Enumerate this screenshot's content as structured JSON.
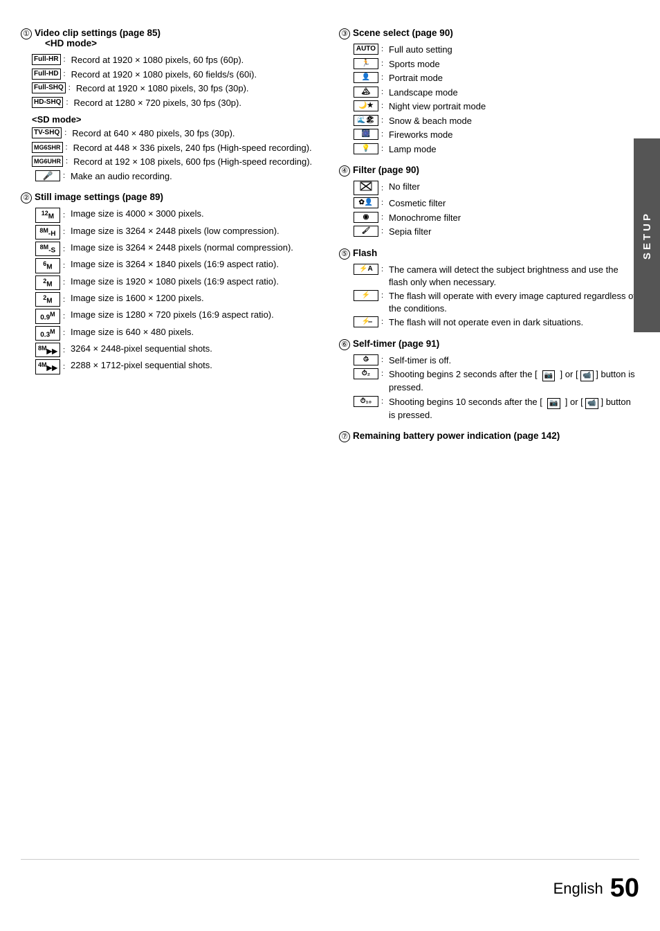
{
  "page": {
    "setup_label": "SETUP",
    "footer": {
      "language": "English",
      "page_number": "50"
    }
  },
  "left_column": {
    "section1": {
      "num": "①",
      "title": "Video clip settings (page 85) <HD mode>",
      "items": [
        {
          "icon": "Full-HR",
          "colon": ":",
          "text": "Record at 1920 × 1080 pixels, 60 fps (60p)."
        },
        {
          "icon": "Full-HD",
          "colon": ":",
          "text": "Record at 1920 × 1080 pixels, 60 fields/s (60i)."
        },
        {
          "icon": "Full-SHQ",
          "colon": ":",
          "text": "Record at 1920 × 1080 pixels, 30 fps (30p)."
        },
        {
          "icon": "HD-SHQ",
          "colon": ":",
          "text": "Record at 1280 × 720 pixels, 30 fps (30p)."
        }
      ],
      "sd_title": "<SD mode>",
      "sd_items": [
        {
          "icon": "TV-SHQ",
          "colon": ":",
          "text": "Record at 640 × 480 pixels, 30 fps (30p)."
        },
        {
          "icon": "MG6SHR",
          "colon": ":",
          "text": "Record at 448 × 336 pixels, 240 fps (High-speed recording)."
        },
        {
          "icon": "MG6UHR",
          "colon": ":",
          "text": "Record at 192 × 108 pixels, 600 fps (High-speed recording)."
        },
        {
          "icon": "🎤",
          "colon": ":",
          "text": "Make an audio recording.",
          "special": true
        }
      ]
    },
    "section2": {
      "num": "②",
      "title": "Still image settings (page 89)",
      "items": [
        {
          "icon": "12M",
          "colon": ":",
          "text": "Image size is 4000 × 3000 pixels."
        },
        {
          "icon": "8M-H",
          "colon": ":",
          "text": "Image size is 3264 × 2448 pixels (low compression)."
        },
        {
          "icon": "8M-S",
          "colon": ":",
          "text": "Image size is 3264 × 2448 pixels (normal compression)."
        },
        {
          "icon": "6M",
          "colon": ":",
          "text": "Image size is 3264 × 1840 pixels (16:9 aspect ratio)."
        },
        {
          "icon": "2M",
          "colon": ":",
          "text": "Image size is 1920 × 1080 pixels (16:9 aspect ratio)."
        },
        {
          "icon": "2M",
          "colon": ":",
          "text": "Image size is 1600 × 1200 pixels."
        },
        {
          "icon": "0.9M",
          "colon": ":",
          "text": "Image size is 1280 × 720 pixels (16:9 aspect ratio)."
        },
        {
          "icon": "0.3M",
          "colon": ":",
          "text": "Image size is 640 × 480 pixels."
        },
        {
          "icon": "8M⏩",
          "colon": ":",
          "text": "3264 × 2448-pixel sequential shots."
        },
        {
          "icon": "4M⏩",
          "colon": ":",
          "text": "2288 × 1712-pixel sequential shots."
        }
      ]
    }
  },
  "right_column": {
    "section3": {
      "num": "③",
      "title": "Scene select (page 90)",
      "items": [
        {
          "icon": "AUTO",
          "colon": ":",
          "text": "Full auto setting"
        },
        {
          "icon": "🏃",
          "colon": ":",
          "text": "Sports mode"
        },
        {
          "icon": "👤",
          "colon": ":",
          "text": "Portrait mode"
        },
        {
          "icon": "🏔",
          "colon": ":",
          "text": "Landscape mode"
        },
        {
          "icon": "🌙★",
          "colon": ":",
          "text": "Night view portrait mode"
        },
        {
          "icon": "🌊🏖",
          "colon": ":",
          "text": "Snow & beach mode"
        },
        {
          "icon": "🎆",
          "colon": ":",
          "text": "Fireworks mode"
        },
        {
          "icon": "💡",
          "colon": ":",
          "text": "Lamp mode"
        }
      ]
    },
    "section4": {
      "num": "④",
      "title": "Filter (page 90)",
      "items": [
        {
          "icon": "⊠",
          "colon": ":",
          "text": "No filter"
        },
        {
          "icon": "✿",
          "colon": ":",
          "text": "Cosmetic filter"
        },
        {
          "icon": "◉",
          "colon": ":",
          "text": "Monochrome filter"
        },
        {
          "icon": "🖌",
          "colon": ":",
          "text": "Sepia filter"
        }
      ]
    },
    "section5": {
      "num": "⑤",
      "title": "Flash",
      "items": [
        {
          "icon": "⚡A",
          "colon": ":",
          "text": "The camera will detect the subject brightness and use the flash only when necessary."
        },
        {
          "icon": "⚡",
          "colon": ":",
          "text": "The flash will operate with every image captured regardless of the conditions."
        },
        {
          "icon": "⚡̶",
          "colon": ":",
          "text": "The flash will not operate even in dark situations."
        }
      ]
    },
    "section6": {
      "num": "⑥",
      "title": "Self-timer (page 91)",
      "items": [
        {
          "icon": "⏱",
          "colon": ":",
          "text": "Self-timer is off."
        },
        {
          "icon": "⏱₂",
          "colon": ":",
          "text": "Shooting begins 2 seconds after the [ 📷 ] or [ 📹 ] button is pressed."
        },
        {
          "icon": "⏱₁₀",
          "colon": ":",
          "text": "Shooting begins 10 seconds after the [ 📷 ] or [ 📹 ] button is pressed."
        }
      ]
    },
    "section7": {
      "num": "⑦",
      "title": "Remaining battery power indication (page 142)"
    }
  }
}
